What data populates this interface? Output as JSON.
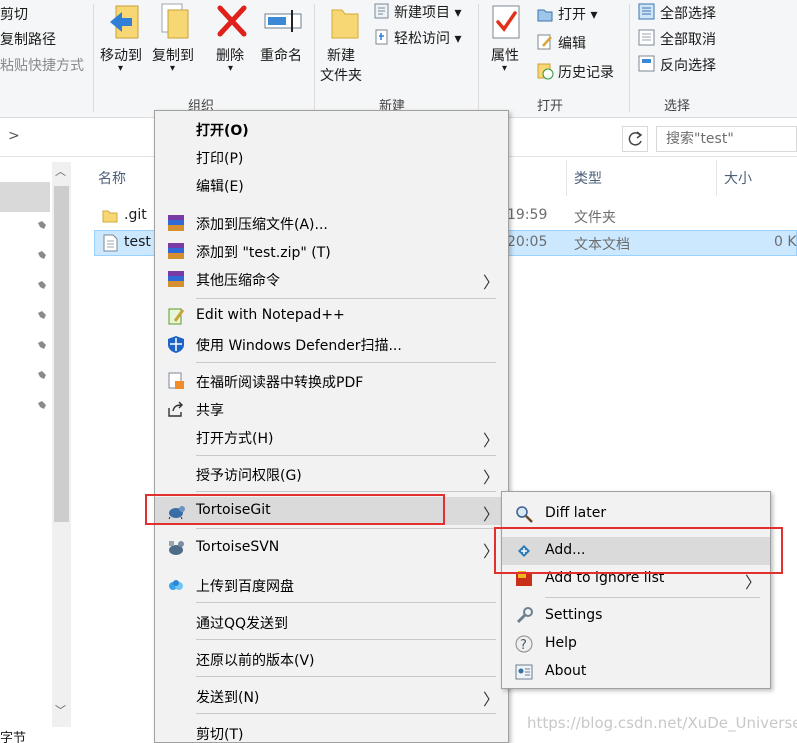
{
  "ribbon": {
    "clipboard": {
      "cut": "剪切",
      "copy_path": "复制路径",
      "paste_shortcut": "粘贴快捷方式"
    },
    "organize": {
      "move_to": "移动到",
      "copy_to": "复制到",
      "delete": "删除",
      "rename": "重命名",
      "group_label": "组织"
    },
    "new": {
      "new_folder_line1": "新建",
      "new_folder_line2": "文件夹",
      "new_item": "新建项目 ▾",
      "easy_access": "轻松访问 ▾",
      "group_label": "新建"
    },
    "open": {
      "properties": "属性",
      "open": "打开 ▾",
      "edit": "编辑",
      "history": "历史记录",
      "group_label": "打开"
    },
    "select": {
      "select_all": "全部选择",
      "select_none": "全部取消",
      "invert": "反向选择",
      "group_label": "选择"
    }
  },
  "address": {
    "chevron": ">",
    "search_placeholder": "搜索\"test\""
  },
  "columns": {
    "name": "名称",
    "type": "类型",
    "size": "大小"
  },
  "files": [
    {
      "name": ".git",
      "time": "19:59",
      "type": "文件夹",
      "size": ""
    },
    {
      "name": "test",
      "time": "20:05",
      "type": "文本文档",
      "size": "0 K"
    }
  ],
  "nav_bottom_label": "字节",
  "context_menu": {
    "items": [
      {
        "label": "打开(O)"
      },
      {
        "label": "打印(P)"
      },
      {
        "label": "编辑(E)"
      },
      {
        "label": "添加到压缩文件(A)..."
      },
      {
        "label": "添加到 \"test.zip\" (T)"
      },
      {
        "label": "其他压缩命令"
      },
      {
        "label": "Edit with Notepad++"
      },
      {
        "label": "使用 Windows Defender扫描..."
      },
      {
        "label": "在福昕阅读器中转换成PDF"
      },
      {
        "label": "共享"
      },
      {
        "label": "打开方式(H)"
      },
      {
        "label": "授予访问权限(G)"
      },
      {
        "label": "TortoiseGit"
      },
      {
        "label": "TortoiseSVN"
      },
      {
        "label": "上传到百度网盘"
      },
      {
        "label": "通过QQ发送到"
      },
      {
        "label": "还原以前的版本(V)"
      },
      {
        "label": "发送到(N)"
      },
      {
        "label": "剪切(T)"
      }
    ]
  },
  "submenu": {
    "items": [
      {
        "label": "Diff later"
      },
      {
        "label": "Add..."
      },
      {
        "label": "Add to ignore list"
      },
      {
        "label": "Settings"
      },
      {
        "label": "Help"
      },
      {
        "label": "About"
      }
    ]
  },
  "watermark": "https://blog.csdn.net/XuDe_Universe",
  "colors": {
    "highlight_red": "#e0312e",
    "selected_row": "#cce8ff",
    "menu_bg": "#f2f2f2"
  }
}
